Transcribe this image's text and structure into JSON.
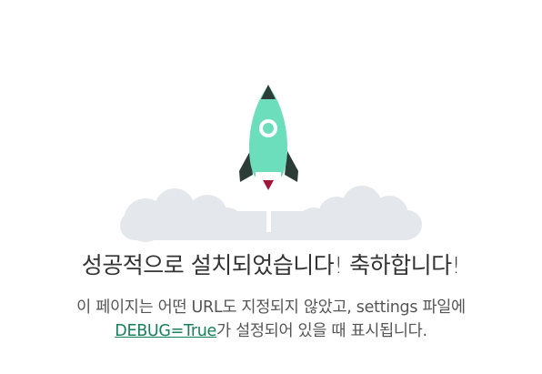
{
  "heading": "성공적으로 설치되었습니다! 축하합니다!",
  "description": {
    "line1": "이 페이지는 어떤 URL도 지정되지 않았고, settings 파일에",
    "link": "DEBUG=True",
    "line2_rest": "가 설정되어 있을 때 표시됩니다."
  },
  "colors": {
    "rocket_body": "#6ddebb",
    "rocket_fins": "#2c3c36",
    "flame": "#a3163b",
    "clouds": "#e4e7ec",
    "link": "#17805a"
  },
  "icons": {
    "rocket": "rocket-icon",
    "clouds": "cloud-icon"
  }
}
